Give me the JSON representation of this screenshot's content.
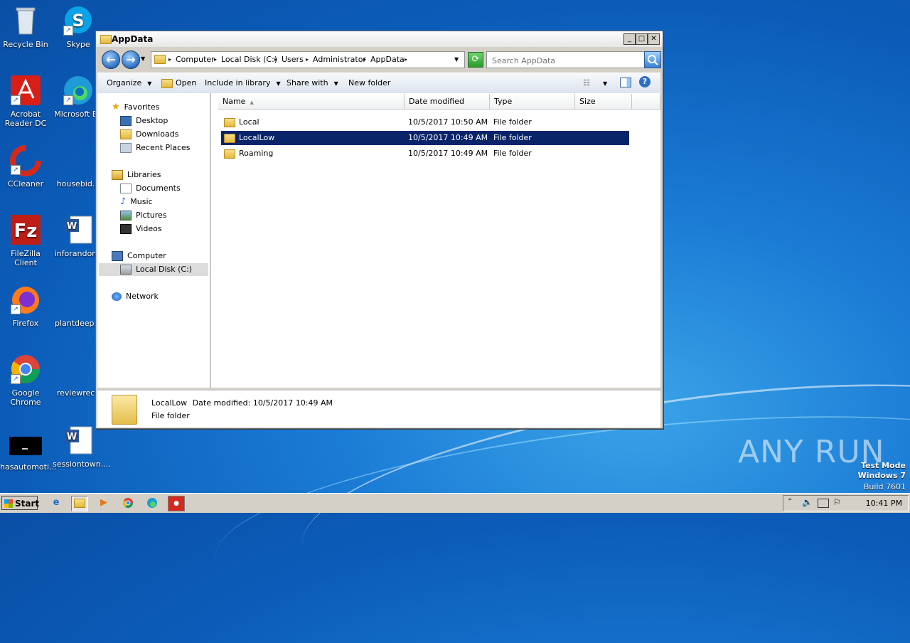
{
  "desktop": {
    "icons": [
      {
        "label": "Recycle Bin"
      },
      {
        "label": "Skype"
      },
      {
        "label": "Acrobat Reader DC"
      },
      {
        "label": "Microsoft Ed"
      },
      {
        "label": "CCleaner"
      },
      {
        "label": "housebid.p"
      },
      {
        "label": "FileZilla Client"
      },
      {
        "label": "inforandom."
      },
      {
        "label": "Firefox"
      },
      {
        "label": "plantdeep.p"
      },
      {
        "label": "Google Chrome"
      },
      {
        "label": "reviewrece"
      },
      {
        "label": "hasautomoti..."
      },
      {
        "label": "sessiontown...."
      }
    ]
  },
  "window": {
    "title": "AppData",
    "breadcrumbs": [
      "Computer",
      "Local Disk (C:)",
      "Users",
      "Administrator",
      "AppData"
    ],
    "search_placeholder": "Search AppData",
    "toolbar": {
      "organize": "Organize",
      "open": "Open",
      "include_in_library": "Include in library",
      "share_with": "Share with",
      "new_folder": "New folder"
    },
    "nav": {
      "favorites": "Favorites",
      "desktop": "Desktop",
      "downloads": "Downloads",
      "recent_places": "Recent Places",
      "libraries": "Libraries",
      "documents": "Documents",
      "music": "Music",
      "pictures": "Pictures",
      "videos": "Videos",
      "computer": "Computer",
      "local_disk": "Local Disk (C:)",
      "network": "Network"
    },
    "columns": {
      "name": "Name",
      "date": "Date modified",
      "type": "Type",
      "size": "Size"
    },
    "files": [
      {
        "name": "Local",
        "date": "10/5/2017 10:50 AM",
        "type": "File folder"
      },
      {
        "name": "LocalLow",
        "date": "10/5/2017 10:49 AM",
        "type": "File folder"
      },
      {
        "name": "Roaming",
        "date": "10/5/2017 10:49 AM",
        "type": "File folder"
      }
    ],
    "details": {
      "name": "LocalLow",
      "date_label": "Date modified:",
      "date": "10/5/2017 10:49 AM",
      "type": "File folder"
    }
  },
  "taskbar": {
    "start": "Start",
    "clock": "10:41 PM"
  },
  "watermark": "ANY RUN",
  "testmode": {
    "line1": "Test Mode",
    "line2": "Windows 7",
    "line3": "Build 7601"
  },
  "colors": {
    "selection": "#0a246a",
    "window_chrome": "#d4d0c8"
  }
}
